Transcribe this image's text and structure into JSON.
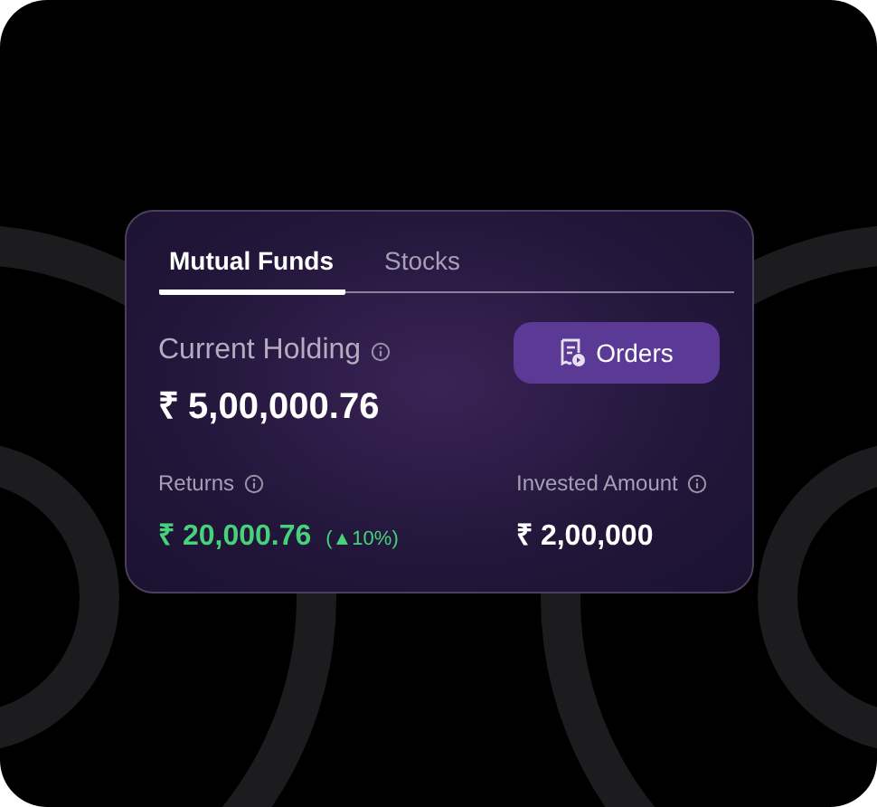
{
  "tabs": [
    {
      "label": "Mutual Funds",
      "selected": true
    },
    {
      "label": "Stocks",
      "selected": false
    }
  ],
  "holding": {
    "label": "Current Holding",
    "value": "₹ 5,00,000.76"
  },
  "orders_button": {
    "label": "Orders"
  },
  "returns": {
    "label": "Returns",
    "value": "₹ 20,000.76",
    "change": "(▲10%)"
  },
  "invested": {
    "label": "Invested Amount",
    "value": "₹ 2,00,000"
  }
}
